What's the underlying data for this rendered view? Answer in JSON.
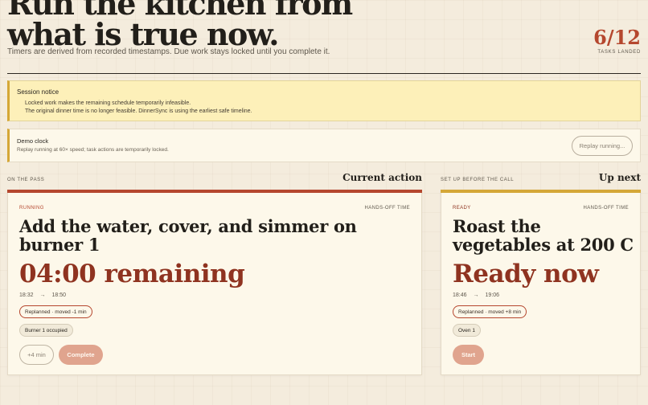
{
  "header": {
    "title_line1": "Run the kitchen from",
    "title_line2": "what is true now.",
    "subtitle": "Timers are derived from recorded timestamps. Due work stays locked until you complete it.",
    "progress_value": "6/12",
    "progress_label": "TASKS LANDED"
  },
  "session_notice": {
    "title": "Session notice",
    "lines": [
      "Locked work makes the remaining schedule temporarily infeasible.",
      "The original dinner time is no longer feasible. DinnerSync is using the earliest safe timeline."
    ]
  },
  "demo_clock": {
    "title": "Demo clock",
    "subtitle": "Replay running at 60× speed; task actions are temporarily locked.",
    "button_label": "Replay running..."
  },
  "current": {
    "kicker": "ON THE PASS",
    "heading": "Current action",
    "status": "RUNNING",
    "mode": "HANDS-OFF TIME",
    "task": "Add the water, cover, and simmer on burner 1",
    "big_text": "04:00 remaining",
    "start_time": "18:32",
    "arrow": "→",
    "end_time": "18:50",
    "replan_chip": "Replanned · moved -1 min",
    "resource_chip": "Burner 1 occupied",
    "extend_label": "+4 min",
    "complete_label": "Complete"
  },
  "next": {
    "kicker": "SET UP BEFORE THE CALL",
    "heading": "Up next",
    "status": "READY",
    "mode": "HANDS-OFF TIME",
    "task": "Roast the vegetables at 200 C",
    "big_text": "Ready now",
    "start_time": "18:46",
    "arrow": "→",
    "end_time": "19:06",
    "replan_chip": "Replanned · moved +8 min",
    "resource_chip": "Oven 1",
    "start_label": "Start"
  },
  "colors": {
    "accent_running": "#b5472e",
    "accent_ready": "#d5a737",
    "countdown": "#8f3320"
  }
}
